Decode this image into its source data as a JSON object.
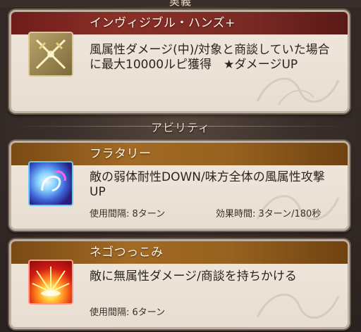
{
  "section_top": {
    "label": "奥義"
  },
  "ougi": {
    "name": "インヴィジブル・ハンズ+",
    "description": "風属性ダメージ(中)/対象と商談していた場合に最大10000ルピ獲得　★ダメージUP",
    "icon": "crossed-swords-icon"
  },
  "ability_section": {
    "label": "アビリティ"
  },
  "abilities": [
    {
      "name": "フラタリー",
      "description": "敵の弱体耐性DOWN/味方全体の風属性攻撃UP",
      "cooldown": "使用間隔: 8ターン",
      "duration": "効果時間: 3ターン/180秒",
      "icon": "fluttery-skill-icon"
    },
    {
      "name": "ネゴつっこみ",
      "description": "敵に無属性ダメージ/商談を持ちかける",
      "cooldown": "使用間隔: 6ターン",
      "icon": "burst-skill-icon"
    }
  ],
  "colors": {
    "ougi_header": "#7a2a24",
    "ability_header": "#a26a25",
    "card_bg": "#efe6dc"
  }
}
